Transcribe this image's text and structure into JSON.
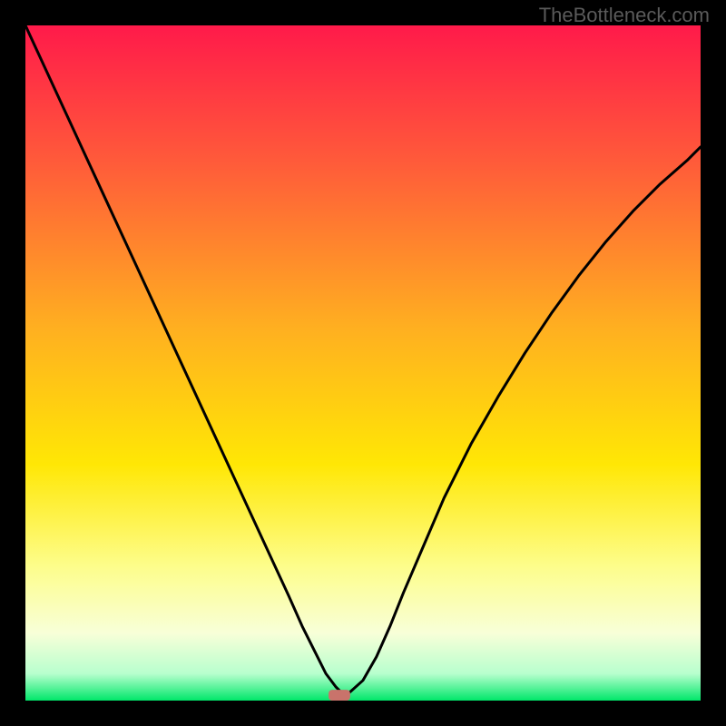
{
  "watermark": "TheBottleneck.com",
  "chart_data": {
    "type": "line",
    "title": "",
    "xlabel": "",
    "ylabel": "",
    "xlim": [
      0,
      100
    ],
    "ylim": [
      0,
      100
    ],
    "background_gradient": {
      "stops": [
        {
          "offset": 0,
          "color": "#ff1a4a"
        },
        {
          "offset": 20,
          "color": "#ff5a3a"
        },
        {
          "offset": 45,
          "color": "#ffb020"
        },
        {
          "offset": 65,
          "color": "#ffe705"
        },
        {
          "offset": 80,
          "color": "#fdfd8a"
        },
        {
          "offset": 90,
          "color": "#f8ffd8"
        },
        {
          "offset": 96,
          "color": "#b8ffce"
        },
        {
          "offset": 100,
          "color": "#00e76a"
        }
      ]
    },
    "series": [
      {
        "name": "bottleneck-curve",
        "stroke": "#000000",
        "stroke_width": 3,
        "x": [
          0,
          3,
          6,
          9,
          12,
          15,
          18,
          21,
          24,
          27,
          30,
          33,
          36,
          39,
          41,
          43,
          44.5,
          46,
          47,
          48,
          50,
          52,
          54,
          56,
          59,
          62,
          66,
          70,
          74,
          78,
          82,
          86,
          90,
          94,
          98,
          100
        ],
        "y": [
          100,
          93.5,
          87,
          80.5,
          74,
          67.5,
          61,
          54.5,
          48,
          41.5,
          35,
          28.5,
          22,
          15.5,
          11,
          7,
          4,
          2,
          1,
          1.2,
          3,
          6.5,
          11,
          16,
          23,
          30,
          38,
          45,
          51.5,
          57.5,
          63,
          68,
          72.5,
          76.5,
          80,
          82
        ]
      }
    ],
    "marker": {
      "name": "optimal-point",
      "x": 46.5,
      "y": 0.8,
      "width_x": 3.2,
      "height_y": 1.6,
      "fill": "#c9736b"
    }
  }
}
